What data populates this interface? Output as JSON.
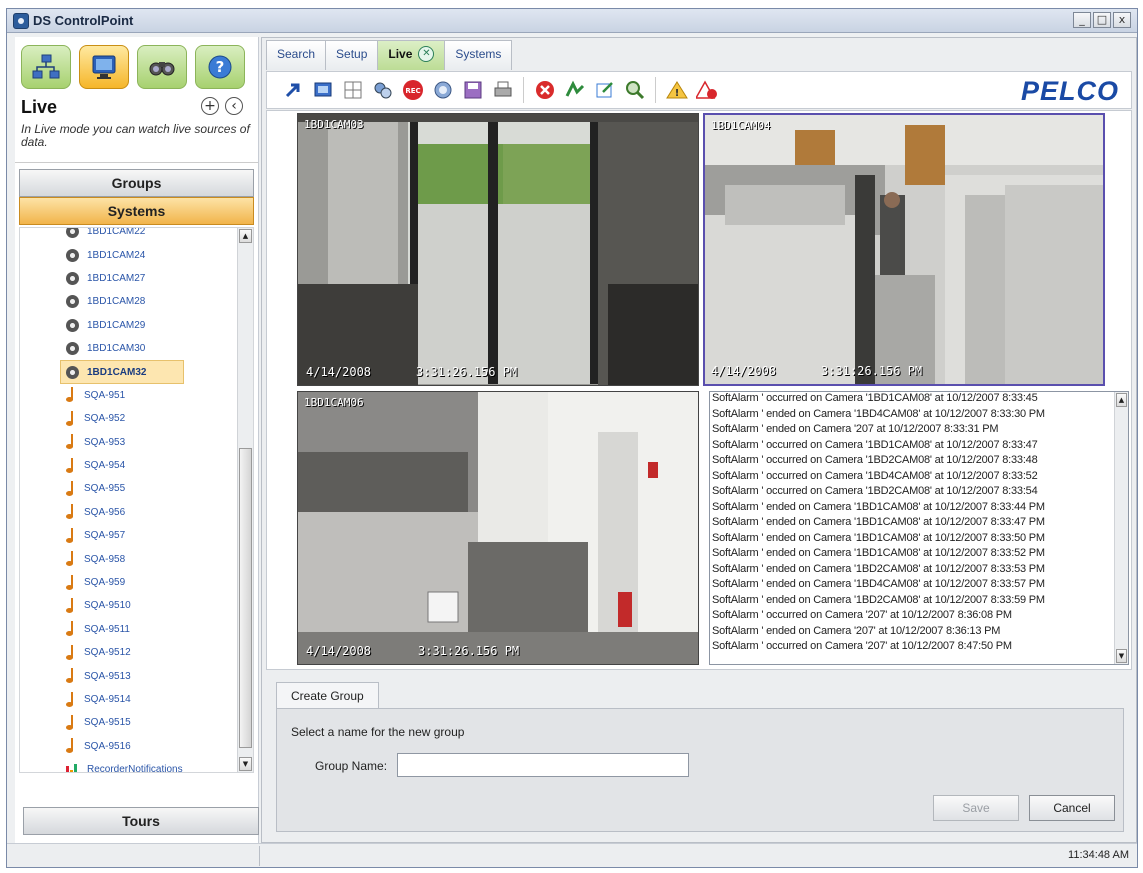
{
  "window": {
    "title": "DS ControlPoint",
    "buttons": [
      "_",
      "□",
      "x"
    ]
  },
  "left": {
    "mode_title": "Live",
    "mode_description": "In Live mode you can watch live sources of data.",
    "sections": {
      "groups": "Groups",
      "systems": "Systems",
      "tours": "Tours"
    },
    "tree_items": [
      {
        "label": "1BD1CAM22",
        "icon": "camera-icon"
      },
      {
        "label": "1BD1CAM24",
        "icon": "camera-icon"
      },
      {
        "label": "1BD1CAM27",
        "icon": "camera-icon"
      },
      {
        "label": "1BD1CAM28",
        "icon": "camera-icon"
      },
      {
        "label": "1BD1CAM29",
        "icon": "camera-icon"
      },
      {
        "label": "1BD1CAM30",
        "icon": "camera-icon"
      },
      {
        "label": "1BD1CAM32",
        "icon": "camera-icon",
        "selected": true
      },
      {
        "label": "SQA-951",
        "icon": "audio-icon"
      },
      {
        "label": "SQA-952",
        "icon": "audio-icon"
      },
      {
        "label": "SQA-953",
        "icon": "audio-icon"
      },
      {
        "label": "SQA-954",
        "icon": "audio-icon"
      },
      {
        "label": "SQA-955",
        "icon": "audio-icon"
      },
      {
        "label": "SQA-956",
        "icon": "audio-icon"
      },
      {
        "label": "SQA-957",
        "icon": "audio-icon"
      },
      {
        "label": "SQA-958",
        "icon": "audio-icon"
      },
      {
        "label": "SQA-959",
        "icon": "audio-icon"
      },
      {
        "label": "SQA-9510",
        "icon": "audio-icon"
      },
      {
        "label": "SQA-9511",
        "icon": "audio-icon"
      },
      {
        "label": "SQA-9512",
        "icon": "audio-icon"
      },
      {
        "label": "SQA-9513",
        "icon": "audio-icon"
      },
      {
        "label": "SQA-9514",
        "icon": "audio-icon"
      },
      {
        "label": "SQA-9515",
        "icon": "audio-icon"
      },
      {
        "label": "SQA-9516",
        "icon": "audio-icon"
      },
      {
        "label": "RecorderNotifications",
        "icon": "chart-icon"
      }
    ]
  },
  "tabs": [
    {
      "label": "Search",
      "active": false
    },
    {
      "label": "Setup",
      "active": false
    },
    {
      "label": "Live",
      "active": true
    },
    {
      "label": "Systems",
      "active": false
    }
  ],
  "toolbar": {
    "icons": [
      "arrow-icon",
      "fullscreen-icon",
      "grid-layout-icon",
      "connect-icon",
      "record-icon",
      "snapshot-icon",
      "save-icon",
      "print-icon",
      "stop-icon",
      "route-icon",
      "edit-icon",
      "zoom-icon",
      "alarm-icon",
      "clear-alarm-icon"
    ],
    "brand": "PELCO"
  },
  "cameras": [
    {
      "label": "1BD1CAM03",
      "date": "4/14/2008",
      "time": "3:31:26.156 PM"
    },
    {
      "label": "1BD1CAM04",
      "date": "4/14/2008",
      "time": "3:31:26.156 PM"
    },
    {
      "label": "1BD1CAM06",
      "date": "4/14/2008",
      "time": "3:31:26.156 PM"
    }
  ],
  "log": [
    "SoftAlarm ' occurred on Camera '1BD1CAM08' at 10/12/2007 8:33:45",
    "SoftAlarm ' ended on Camera '1BD4CAM08' at 10/12/2007 8:33:30 PM",
    "SoftAlarm ' ended on Camera '207 at 10/12/2007 8:33:31 PM",
    "SoftAlarm ' occurred on Camera '1BD1CAM08' at 10/12/2007 8:33:47",
    "SoftAlarm ' occurred on Camera '1BD2CAM08' at 10/12/2007 8:33:48",
    "SoftAlarm ' occurred on Camera '1BD4CAM08' at 10/12/2007 8:33:52",
    "SoftAlarm ' occurred on Camera '1BD2CAM08' at 10/12/2007 8:33:54",
    "SoftAlarm ' ended on Camera '1BD1CAM08' at 10/12/2007 8:33:44 PM",
    "SoftAlarm ' ended on Camera '1BD1CAM08' at 10/12/2007 8:33:47 PM",
    "SoftAlarm ' ended on Camera '1BD1CAM08' at 10/12/2007 8:33:50 PM",
    "SoftAlarm ' ended on Camera '1BD1CAM08' at 10/12/2007 8:33:52 PM",
    "SoftAlarm ' ended on Camera '1BD2CAM08' at 10/12/2007 8:33:53 PM",
    "SoftAlarm ' ended on Camera '1BD4CAM08' at 10/12/2007 8:33:57 PM",
    "SoftAlarm ' ended on Camera '1BD2CAM08' at 10/12/2007 8:33:59 PM",
    "SoftAlarm ' occurred on Camera '207' at 10/12/2007 8:36:08 PM",
    "SoftAlarm ' ended on Camera '207' at 10/12/2007 8:36:13 PM",
    "SoftAlarm ' occurred on Camera '207' at 10/12/2007 8:47:50 PM"
  ],
  "create_group": {
    "tab_label": "Create Group",
    "prompt": "Select a name for the new group",
    "field_label": "Group Name:",
    "field_value": "",
    "save_label": "Save",
    "cancel_label": "Cancel"
  },
  "status": {
    "time": "11:34:48 AM"
  },
  "colors": {
    "accent": "#f1b44b",
    "brand": "#1a4aa5",
    "live_tab": "#bcdc95"
  }
}
